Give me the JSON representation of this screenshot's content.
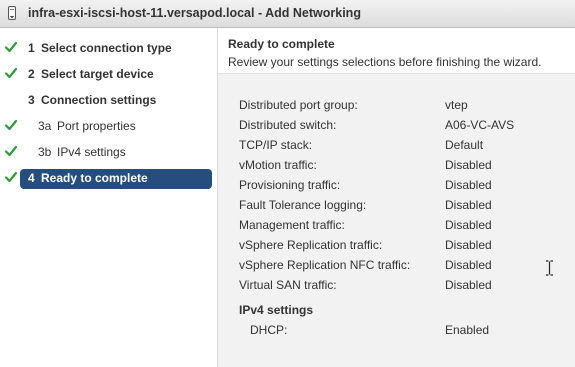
{
  "window": {
    "title": "infra-esxi-iscsi-host-11.versapod.local - Add Networking",
    "icon": "host-device-icon"
  },
  "steps": [
    {
      "number": "1",
      "label": "Select connection type",
      "completed": true,
      "active": false,
      "sub": false
    },
    {
      "number": "2",
      "label": "Select target device",
      "completed": true,
      "active": false,
      "sub": false
    },
    {
      "number": "3",
      "label": "Connection settings",
      "completed": false,
      "active": false,
      "sub": false
    },
    {
      "number": "3a",
      "label": "Port properties",
      "completed": true,
      "active": false,
      "sub": true
    },
    {
      "number": "3b",
      "label": "IPv4 settings",
      "completed": true,
      "active": false,
      "sub": true
    },
    {
      "number": "4",
      "label": "Ready to complete",
      "completed": true,
      "active": true,
      "sub": false
    }
  ],
  "header": {
    "title": "Ready to complete",
    "subtitle": "Review your settings selections before finishing the wizard."
  },
  "summary": [
    {
      "label": "Distributed port group:",
      "value": "vtep"
    },
    {
      "label": "Distributed switch:",
      "value": "A06-VC-AVS"
    },
    {
      "label": "TCP/IP stack:",
      "value": "Default"
    },
    {
      "label": "vMotion traffic:",
      "value": "Disabled"
    },
    {
      "label": "Provisioning traffic:",
      "value": "Disabled"
    },
    {
      "label": "Fault Tolerance logging:",
      "value": "Disabled"
    },
    {
      "label": "Management traffic:",
      "value": "Disabled"
    },
    {
      "label": "vSphere Replication traffic:",
      "value": "Disabled"
    },
    {
      "label": "vSphere Replication NFC traffic:",
      "value": "Disabled"
    },
    {
      "label": "Virtual SAN traffic:",
      "value": "Disabled"
    }
  ],
  "ipv4": {
    "title": "IPv4 settings",
    "rows": [
      {
        "label": "DHCP:",
        "value": "Enabled"
      }
    ]
  },
  "colors": {
    "active_step_bg": "#254e7e",
    "check": "#2e9a3a",
    "content_bg": "#f2f2f2"
  }
}
